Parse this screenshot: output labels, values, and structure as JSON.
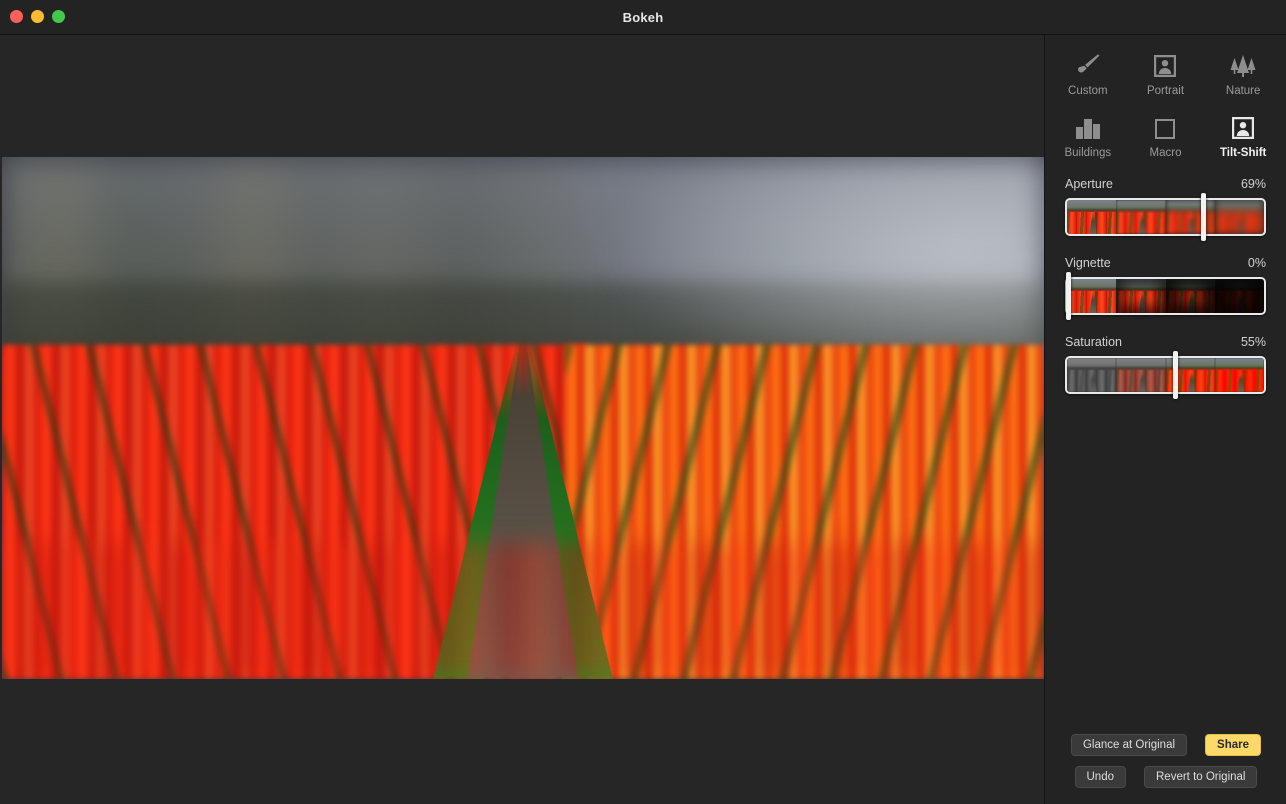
{
  "window": {
    "title": "Bokeh",
    "traffic_lights": [
      {
        "name": "close",
        "color": "#ff6058"
      },
      {
        "name": "minimize",
        "color": "#febc2e"
      },
      {
        "name": "maximize",
        "color": "#42c84b"
      }
    ]
  },
  "canvas": {
    "image_description": "Blurred tilt-shift photograph of a red and orange tulip field with a dirt path converging toward a hazy treeline horizon"
  },
  "panel": {
    "presets": [
      {
        "label": "Custom",
        "icon": "paintbrush-icon",
        "selected": false
      },
      {
        "label": "Portrait",
        "icon": "portrait-frame-icon",
        "selected": false
      },
      {
        "label": "Nature",
        "icon": "trees-icon",
        "selected": false
      },
      {
        "label": "Buildings",
        "icon": "buildings-icon",
        "selected": false
      },
      {
        "label": "Macro",
        "icon": "square-icon",
        "selected": false
      },
      {
        "label": "Tilt-Shift",
        "icon": "portrait-frame-icon",
        "selected": true
      }
    ],
    "sliders": [
      {
        "name": "Aperture",
        "value": "69%",
        "percent": 69,
        "variant": "blur"
      },
      {
        "name": "Vignette",
        "value": "0%",
        "percent": 0,
        "variant": "vignette"
      },
      {
        "name": "Saturation",
        "value": "55%",
        "percent": 55,
        "variant": "saturation"
      }
    ],
    "buttons": {
      "glance": "Glance at Original",
      "share": "Share",
      "undo": "Undo",
      "revert": "Revert to Original"
    },
    "colors": {
      "panel_bg": "#232323",
      "accent": "#fcd968",
      "button_bg": "#3a3a3a",
      "text": "#d2d2d2"
    }
  }
}
